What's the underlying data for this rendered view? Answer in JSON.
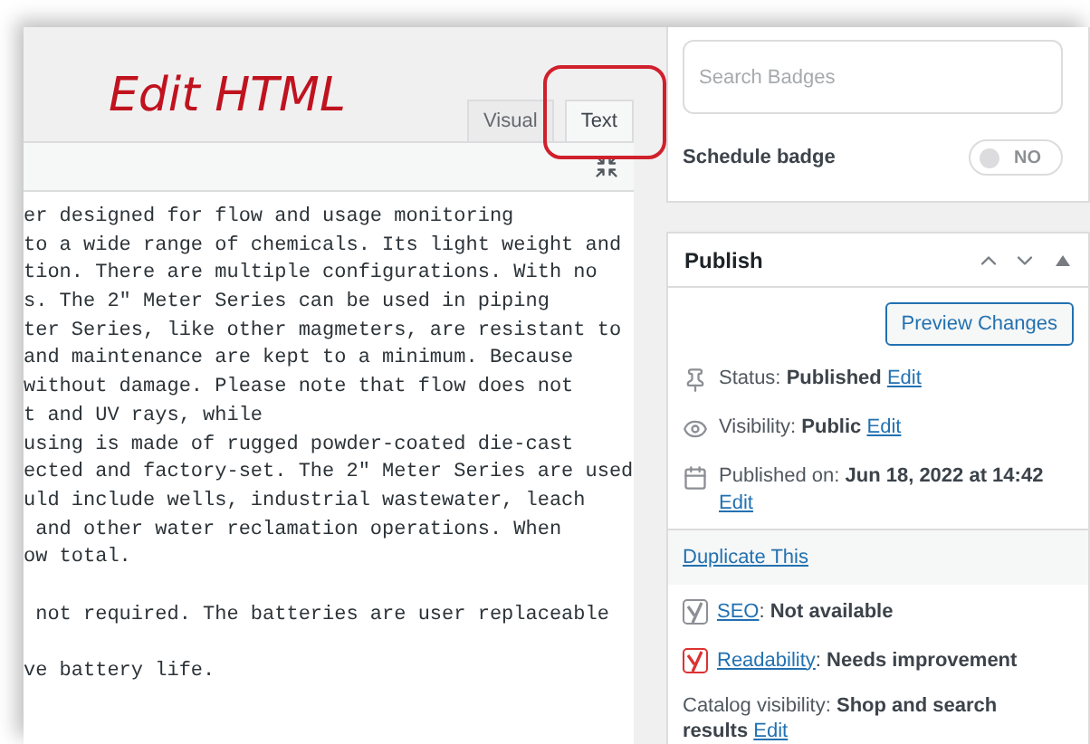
{
  "annotation": {
    "text": "Edit HTML"
  },
  "editor": {
    "tabs": [
      {
        "label": "Visual",
        "selected": false
      },
      {
        "label": "Text",
        "selected": true
      }
    ],
    "paragraphs": [
      [
        "er designed for flow and usage monitoring",
        "to a wide range of chemicals. Its light weight and",
        "tion. There are multiple configurations. With no",
        "s. The 2\" Meter Series can be used in piping",
        "ter Series, like other magmeters, are resistant to",
        "and maintenance are kept to a minimum. Because",
        "without damage. Please note that flow does not",
        "t and UV rays, while",
        "using is made of rugged powder-coated die-cast",
        "ected and factory-set. The 2\" Meter Series are used",
        "uld include wells, industrial wastewater, leach",
        " and other water reclamation operations. When",
        "ow total."
      ],
      [
        " not required. The batteries are user replaceable"
      ],
      [
        "ve battery life."
      ]
    ]
  },
  "badges": {
    "search": {
      "placeholder": "Search Badges"
    },
    "schedule": {
      "label": "Schedule badge",
      "on": false,
      "state_text": "NO"
    }
  },
  "publish": {
    "title": "Publish",
    "preview_button": "Preview Changes",
    "rows": [
      {
        "kind": "status",
        "label": "Status:",
        "value": "Published",
        "link": "Edit"
      },
      {
        "kind": "visibility",
        "label": "Visibility:",
        "value": "Public",
        "link": "Edit"
      },
      {
        "kind": "date",
        "label": "Published on:",
        "value": "Jun 18, 2022 at 14:42",
        "link": "Edit"
      }
    ],
    "duplicate_link": "Duplicate This",
    "analysis": [
      {
        "link": "SEO",
        "separator": ":",
        "value": "Not available",
        "color": "#8c8f94"
      },
      {
        "link": "Readability",
        "separator": ":",
        "value": "Needs improvement",
        "color": "#dc3232"
      }
    ],
    "catalog": {
      "label": "Catalog visibility:",
      "value": "Shop and search results",
      "link": "Edit"
    }
  }
}
